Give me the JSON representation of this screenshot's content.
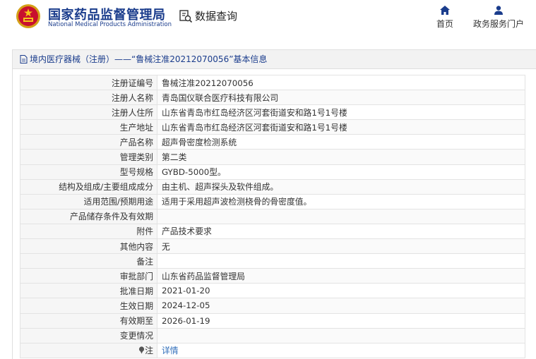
{
  "header": {
    "logo_cn": "国家药品监督管理局",
    "logo_en": "National Medical Products Administration",
    "data_query": "数据查询",
    "nav_home": "首页",
    "nav_portal": "政务服务门户"
  },
  "panel": {
    "title": "境内医疗器械（注册）——“鲁械注准20212070056”基本信息"
  },
  "rows": [
    {
      "label": "注册证编号",
      "value": "鲁械注准20212070056"
    },
    {
      "label": "注册人名称",
      "value": "青岛国仪联合医疗科技有限公司"
    },
    {
      "label": "注册人住所",
      "value": "山东省青岛市红岛经济区河套街道安和路1号1号楼"
    },
    {
      "label": "生产地址",
      "value": "山东省青岛市红岛经济区河套街道安和路1号1号楼"
    },
    {
      "label": "产品名称",
      "value": "超声骨密度检测系统"
    },
    {
      "label": "管理类别",
      "value": "第二类"
    },
    {
      "label": "型号规格",
      "value": "GYBD-5000型。"
    },
    {
      "label": "结构及组成/主要组成成分",
      "value": "由主机、超声探头及软件组成。"
    },
    {
      "label": "适用范围/预期用途",
      "value": "适用于采用超声波检测桡骨的骨密度值。"
    },
    {
      "label": "产品储存条件及有效期",
      "value": ""
    },
    {
      "label": "附件",
      "value": "产品技术要求"
    },
    {
      "label": "其他内容",
      "value": "无"
    },
    {
      "label": "备注",
      "value": ""
    },
    {
      "label": "审批部门",
      "value": "山东省药品监督管理局"
    },
    {
      "label": "批准日期",
      "value": "2021-01-20"
    },
    {
      "label": "生效日期",
      "value": "2024-12-05"
    },
    {
      "label": "有效期至",
      "value": "2026-01-19"
    },
    {
      "label": "变更情况",
      "value": ""
    }
  ],
  "note": {
    "label": "注",
    "link": "详情"
  },
  "colors": {
    "brand": "#1a3c8c",
    "link": "#2a6ab8"
  }
}
